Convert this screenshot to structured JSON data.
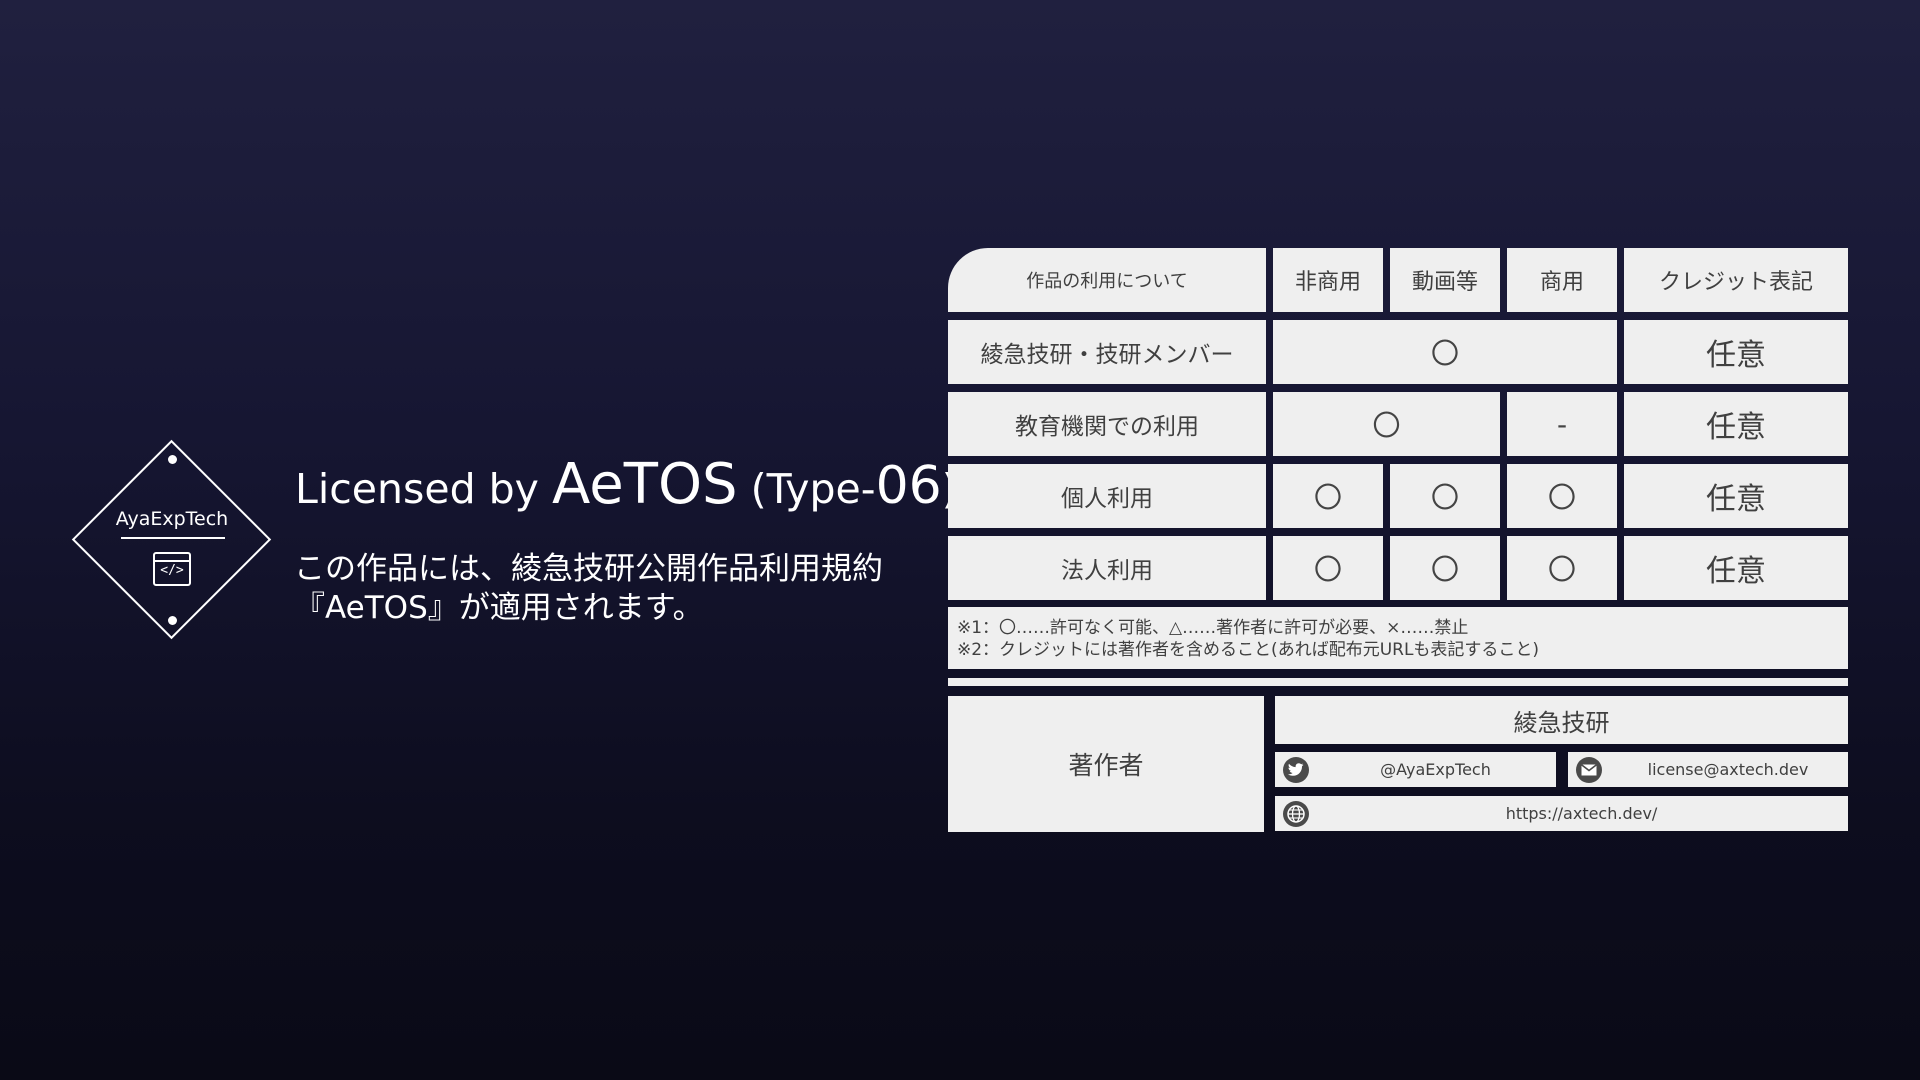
{
  "badge": {
    "name": "AyaExpTech",
    "code_symbol": "</>"
  },
  "title": {
    "prefix": "Licensed by ",
    "brand": "AeTOS",
    "type_open": " (Type-",
    "type_num": "06",
    "type_close": ")"
  },
  "description": {
    "line1": "この作品には、綾急技研公開作品利用規約",
    "line2": "『AeTOS』が適用されます。"
  },
  "table": {
    "headers": [
      "作品の利用について",
      "非商用",
      "動画等",
      "商用",
      "クレジット表記"
    ],
    "rows": [
      {
        "label": "綾急技研・技研メンバー",
        "mark": "〇",
        "credit": "任意"
      },
      {
        "label": "教育機関での利用",
        "mark": "〇",
        "commercial": "-",
        "credit": "任意"
      },
      {
        "label": "個人利用",
        "marks": [
          "〇",
          "〇",
          "〇"
        ],
        "credit": "任意"
      },
      {
        "label": "法人利用",
        "marks": [
          "〇",
          "〇",
          "〇"
        ],
        "credit": "任意"
      }
    ],
    "notes": [
      "※1：〇……許可なく可能、△……著作者に許可が必要、×……禁止",
      "※2：クレジットには著作者を含めること(あれば配布元URLも表記すること)"
    ]
  },
  "author": {
    "label": "著作者",
    "name": "綾急技研",
    "twitter": "@AyaExpTech",
    "email": "license@axtech.dev",
    "website": "https://axtech.dev/",
    "icons": {
      "twitter": "twitter-icon",
      "email": "mail-icon",
      "website": "globe-icon"
    }
  }
}
